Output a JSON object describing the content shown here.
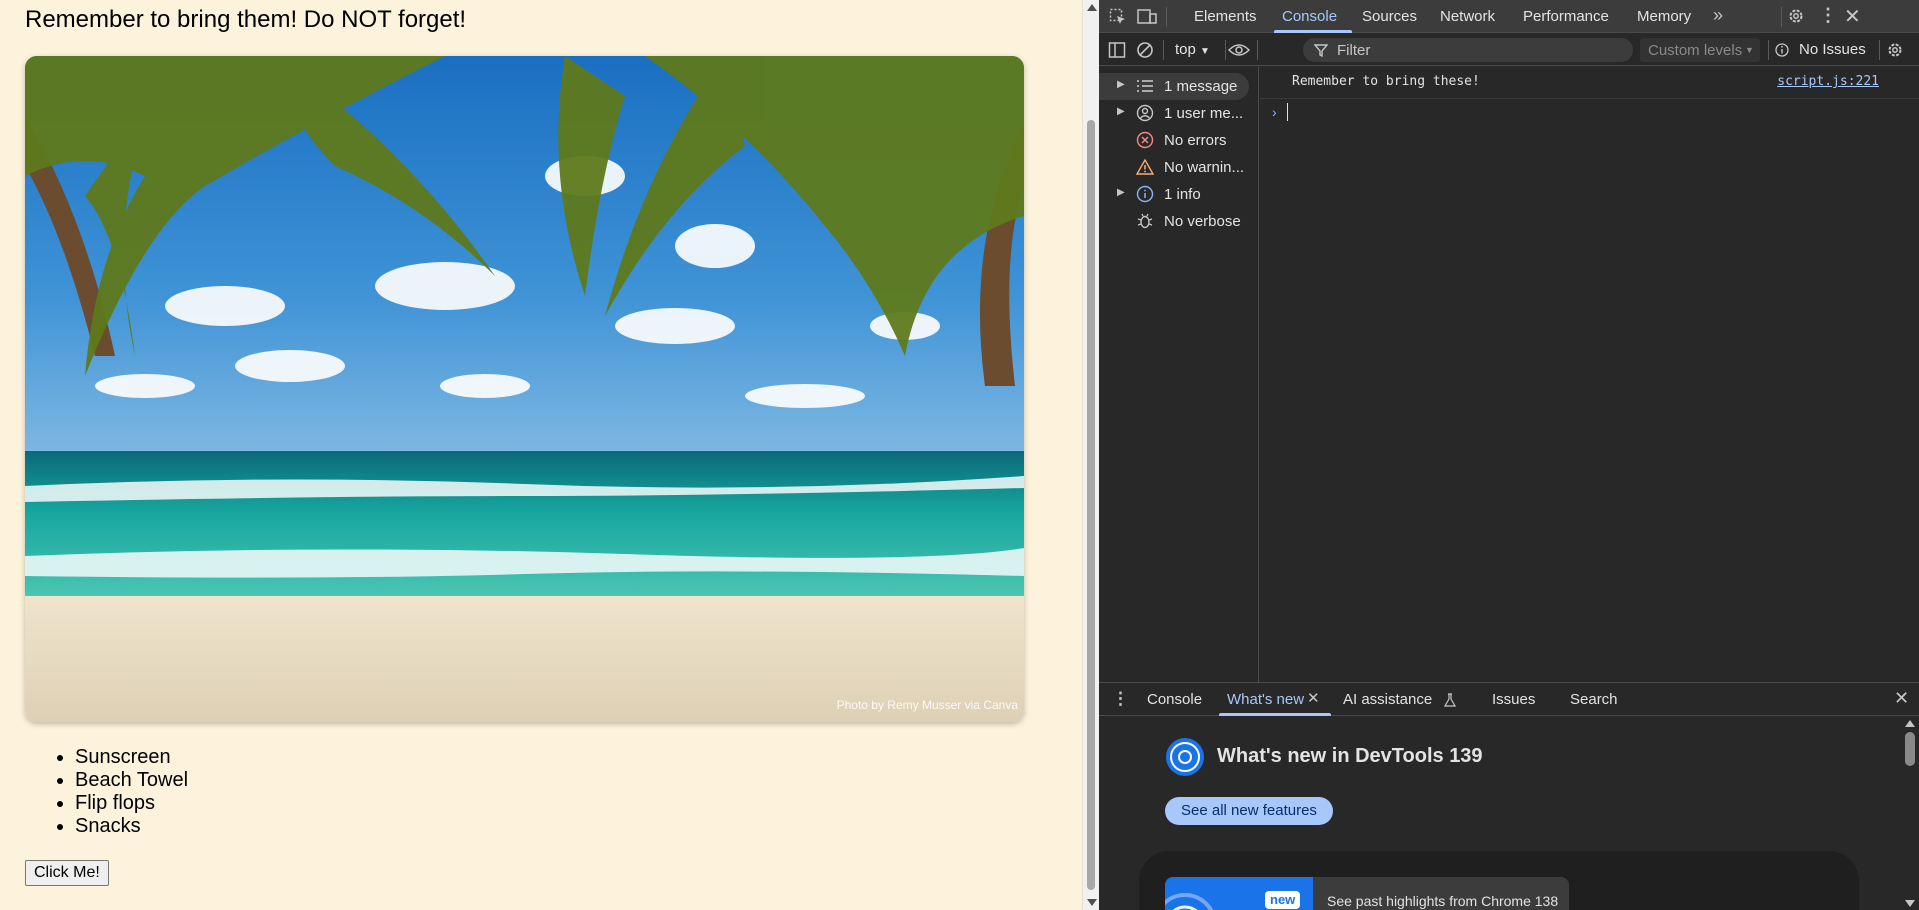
{
  "page": {
    "heading": "Remember to bring them! Do NOT forget!",
    "image_alt": "Tropical beach with palm trees",
    "photo_credit": "Photo by Remy Musser via Canva",
    "items": [
      "Sunscreen",
      "Beach Towel",
      "Flip flops",
      "Snacks"
    ],
    "button_label": "Click Me!"
  },
  "devtools": {
    "tabs": [
      "Elements",
      "Console",
      "Sources",
      "Network",
      "Performance",
      "Memory"
    ],
    "active_tab": "Console",
    "context": "top",
    "filter_placeholder": "Filter",
    "levels_label": "Custom levels",
    "issues_label": "No Issues",
    "sidebar": [
      {
        "label": "1 message",
        "icon": "list-icon"
      },
      {
        "label": "1 user me...",
        "icon": "user-icon"
      },
      {
        "label": "No errors",
        "icon": "error-icon"
      },
      {
        "label": "No warnin...",
        "icon": "warning-icon"
      },
      {
        "label": "1 info",
        "icon": "info-icon"
      },
      {
        "label": "No verbose",
        "icon": "bug-icon"
      }
    ],
    "message": {
      "text": "Remember to bring these!",
      "source": "script.js:221"
    },
    "drawer": {
      "tabs": [
        "Console",
        "What's new",
        "AI assistance",
        "Issues",
        "Search"
      ],
      "active_tab": "What's new",
      "title": "What's new in DevTools 139",
      "button_label": "See all new features",
      "badge": "new",
      "highlight": "See past highlights from Chrome 138"
    }
  },
  "colors": {
    "page_bg": "#fdf3dc",
    "devtools_bg": "#282828",
    "accent": "#a8c7fa",
    "error": "#f28b82",
    "warning": "#fcad70",
    "info": "#8ab4f8"
  }
}
